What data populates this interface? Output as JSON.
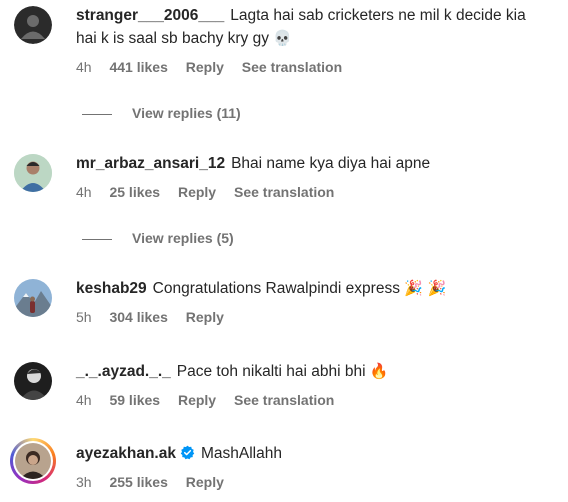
{
  "comments": [
    {
      "username": "stranger___2006___",
      "text": "Lagta hai sab cricketers ne mil k decide kia hai k is saal sb bachy kry gy",
      "emoji": "💀",
      "time": "4h",
      "likes": "441 likes",
      "reply": "Reply",
      "translation": "See translation",
      "view_replies": "View replies (11)"
    },
    {
      "username": "mr_arbaz_ansari_12",
      "text": "Bhai name kya diya hai apne",
      "emoji": "",
      "time": "4h",
      "likes": "25 likes",
      "reply": "Reply",
      "translation": "See translation",
      "view_replies": "View replies (5)"
    },
    {
      "username": "keshab29",
      "text": "Congratulations Rawalpindi express",
      "emoji": "🎉 🎉",
      "time": "5h",
      "likes": "304 likes",
      "reply": "Reply"
    },
    {
      "username": "_._.ayzad._._",
      "text": "Pace toh nikalti hai abhi bhi",
      "emoji": "🔥",
      "time": "4h",
      "likes": "59 likes",
      "reply": "Reply",
      "translation": "See translation"
    },
    {
      "username": "ayezakhan.ak",
      "verified": true,
      "text": "MashAllahh",
      "emoji": "",
      "time": "3h",
      "likes": "255 likes",
      "reply": "Reply"
    }
  ],
  "colors": {
    "text": "#262626",
    "meta": "#737373",
    "verified": "#0095f6"
  }
}
